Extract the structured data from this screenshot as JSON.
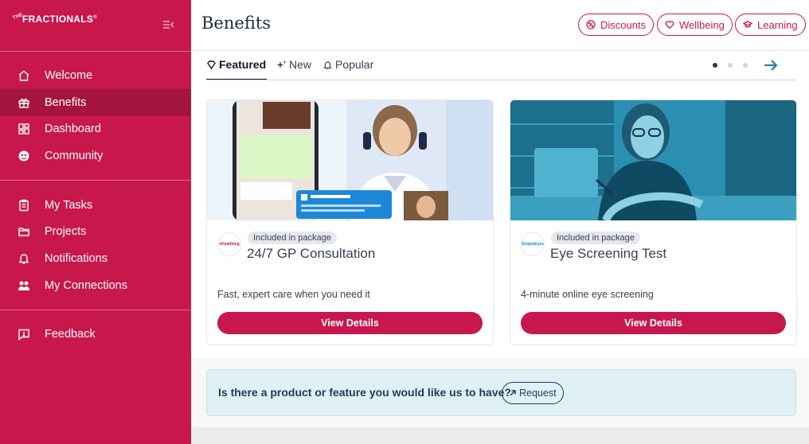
{
  "brand": {
    "name": "FRACTIONALS",
    "prefix": "THE",
    "mark": "®"
  },
  "sidebar": {
    "groups": [
      [
        {
          "label": "Welcome",
          "icon": "home-icon"
        },
        {
          "label": "Benefits",
          "icon": "gift-icon",
          "active": true
        },
        {
          "label": "Dashboard",
          "icon": "dashboard-icon"
        },
        {
          "label": "Community",
          "icon": "community-icon"
        }
      ],
      [
        {
          "label": "My Tasks",
          "icon": "clipboard-icon"
        },
        {
          "label": "Projects",
          "icon": "folder-icon"
        },
        {
          "label": "Notifications",
          "icon": "bell-icon"
        },
        {
          "label": "My Connections",
          "icon": "people-icon"
        }
      ],
      [
        {
          "label": "Feedback",
          "icon": "feedback-icon"
        }
      ]
    ]
  },
  "header": {
    "title": "Benefits",
    "pills": [
      {
        "label": "Discounts",
        "icon": "discount-icon"
      },
      {
        "label": "Wellbeing",
        "icon": "heart-icon"
      },
      {
        "label": "Learning",
        "icon": "graduation-cap-icon"
      }
    ]
  },
  "tabs": [
    {
      "label": "Featured",
      "icon": "diamond-icon",
      "active": true
    },
    {
      "label": "New",
      "icon": "sparkle-icon"
    },
    {
      "label": "Popular",
      "icon": "bell-outline-icon"
    }
  ],
  "carousel": {
    "page_count": 3,
    "active_page": 1
  },
  "cards": [
    {
      "badge": "Included in package",
      "title": "24/7 GP Consultation",
      "description": "Fast, expert care when you need it",
      "button": "View Details",
      "logo_text": "eHealthing"
    },
    {
      "badge": "Included in package",
      "title": "Eye Screening Test",
      "description": "4-minute online eye screening",
      "button": "View Details",
      "logo_text": "SimpleEyes"
    }
  ],
  "request": {
    "question": "Is there a product or feature you would like us to have?",
    "button": "Request"
  },
  "colors": {
    "brand": "#c8174d",
    "brand_dark": "#a5143f",
    "navy": "#1f3b5a",
    "banner_bg": "#dff1f5",
    "teal": "#2b7f9a"
  }
}
